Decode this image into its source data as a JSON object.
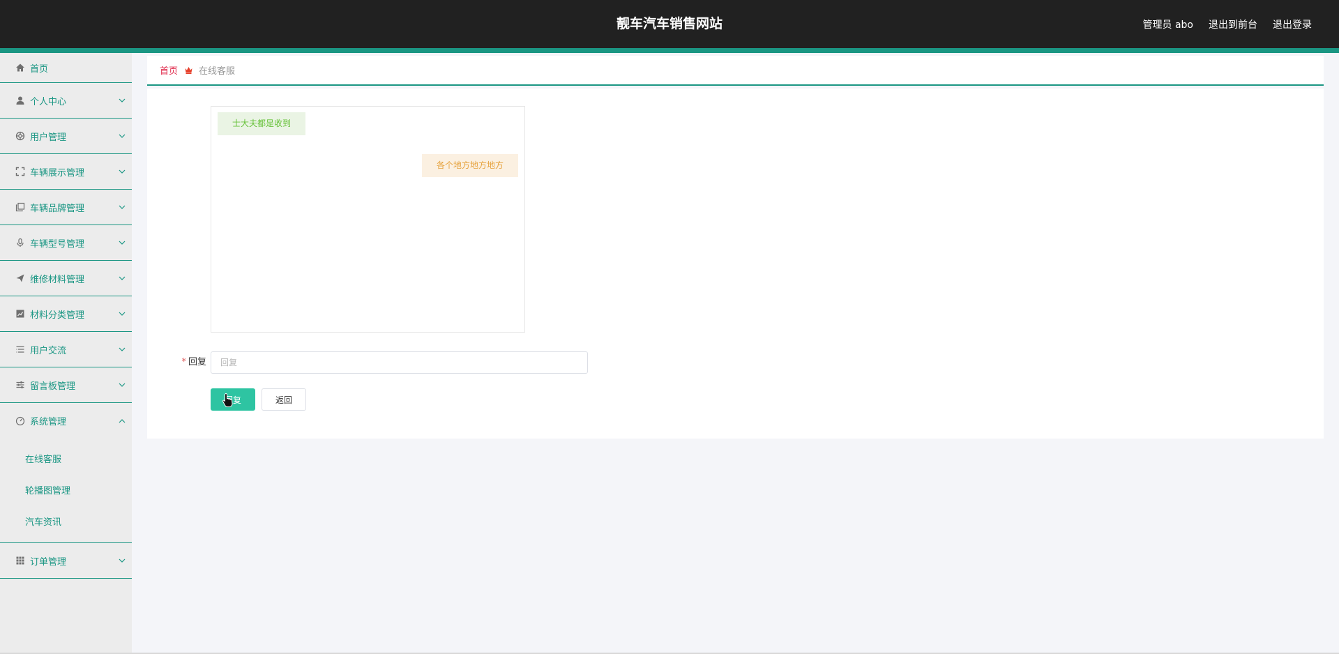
{
  "header": {
    "title": "靓车汽车销售网站",
    "user": "管理员 abo",
    "to_front": "退出到前台",
    "logout": "退出登录"
  },
  "sidebar": {
    "items": [
      {
        "label": "首页",
        "icon": "home-icon"
      },
      {
        "label": "个人中心",
        "icon": "user-icon"
      },
      {
        "label": "用户管理",
        "icon": "help-circle-icon"
      },
      {
        "label": "车辆展示管理",
        "icon": "fullscreen-icon"
      },
      {
        "label": "车辆品牌管理",
        "icon": "copy-icon"
      },
      {
        "label": "车辆型号管理",
        "icon": "microphone-icon"
      },
      {
        "label": "维修材料管理",
        "icon": "send-icon"
      },
      {
        "label": "材料分类管理",
        "icon": "chart-icon"
      },
      {
        "label": "用户交流",
        "icon": "list-icon"
      },
      {
        "label": "留言板管理",
        "icon": "sliders-icon"
      },
      {
        "label": "系统管理",
        "icon": "dashboard-icon"
      },
      {
        "label": "订单管理",
        "icon": "grid-icon"
      }
    ],
    "system_sub": [
      "在线客服",
      "轮播图管理",
      "汽车资讯"
    ]
  },
  "breadcrumb": {
    "home": "首页",
    "current": "在线客服"
  },
  "chat": {
    "messages": [
      {
        "side": "left",
        "text": "士大夫都是收到"
      },
      {
        "side": "right",
        "text": "各个地方地方地方"
      }
    ]
  },
  "form": {
    "reply_label": "回复",
    "reply_placeholder": "回复",
    "reply_value": "",
    "submit_label": "回复",
    "back_label": "返回"
  },
  "colors": {
    "accent": "#1a9683",
    "header_bg": "#212121",
    "primary_button": "#2ec4a2"
  }
}
